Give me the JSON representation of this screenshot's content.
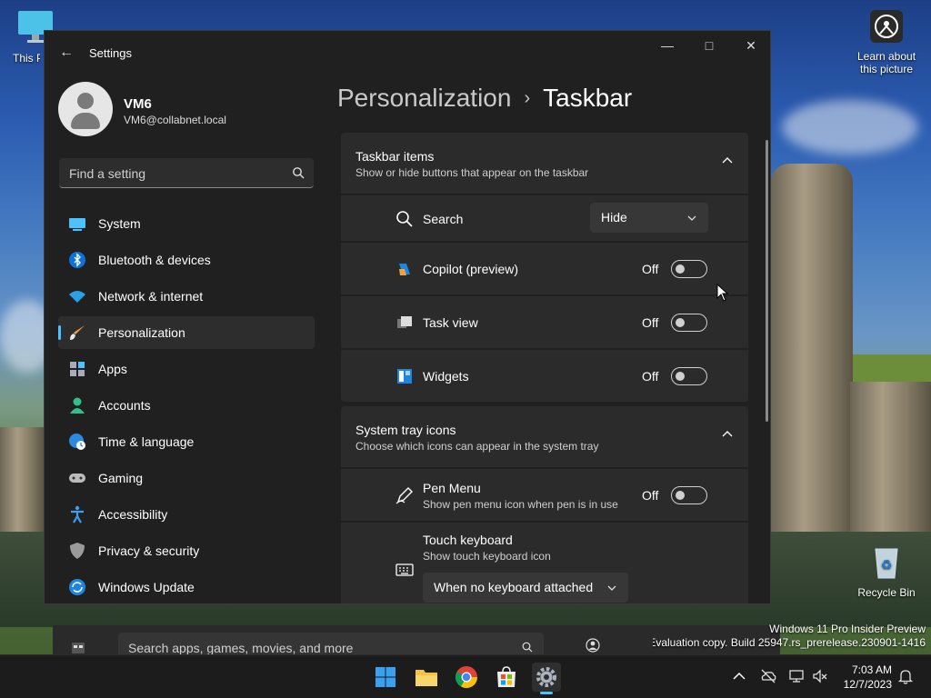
{
  "desktop": {
    "this_pc_label": "This PC",
    "learn_label_1": "Learn about",
    "learn_label_2": "this picture",
    "recycle_label": "Recycle Bin",
    "watermark_1": "Windows 11 Pro Insider Preview",
    "watermark_2": "Evaluation copy. Build 25947.rs_prerelease.230901-1416"
  },
  "window": {
    "title": "Settings",
    "minimize": "—",
    "maximize": "□",
    "close": "✕",
    "back": "←"
  },
  "profile": {
    "name": "VM6",
    "email": "VM6@collabnet.local"
  },
  "search": {
    "placeholder": "Find a setting"
  },
  "nav": {
    "items": [
      {
        "label": "System",
        "icon": "system-icon"
      },
      {
        "label": "Bluetooth & devices",
        "icon": "bluetooth-icon"
      },
      {
        "label": "Network & internet",
        "icon": "wifi-icon"
      },
      {
        "label": "Personalization",
        "icon": "brush-icon",
        "active": true
      },
      {
        "label": "Apps",
        "icon": "apps-icon"
      },
      {
        "label": "Accounts",
        "icon": "account-icon"
      },
      {
        "label": "Time & language",
        "icon": "globe-clock-icon"
      },
      {
        "label": "Gaming",
        "icon": "gamepad-icon"
      },
      {
        "label": "Accessibility",
        "icon": "accessibility-icon"
      },
      {
        "label": "Privacy & security",
        "icon": "shield-icon"
      },
      {
        "label": "Windows Update",
        "icon": "update-icon"
      }
    ]
  },
  "breadcrumb": {
    "parent": "Personalization",
    "separator": "›",
    "current": "Taskbar"
  },
  "taskbar_items": {
    "title": "Taskbar items",
    "subtitle": "Show or hide buttons that appear on the taskbar",
    "search_label": "Search",
    "search_value": "Hide",
    "copilot_label": "Copilot (preview)",
    "copilot_state": "Off",
    "taskview_label": "Task view",
    "taskview_state": "Off",
    "widgets_label": "Widgets",
    "widgets_state": "Off"
  },
  "system_tray": {
    "title": "System tray icons",
    "subtitle": "Choose which icons can appear in the system tray",
    "pen_label": "Pen Menu",
    "pen_sub": "Show pen menu icon when pen is in use",
    "pen_state": "Off",
    "touch_label": "Touch keyboard",
    "touch_sub": "Show touch keyboard icon",
    "touch_value": "When no keyboard attached"
  },
  "store": {
    "search_placeholder": "Search apps, games, movies, and more"
  },
  "clock": {
    "time": "7:03 AM",
    "date": "12/7/2023"
  },
  "colors": {
    "accent": "#4cc2ff",
    "window_bg": "#202020",
    "card_bg": "#2b2b2b"
  }
}
